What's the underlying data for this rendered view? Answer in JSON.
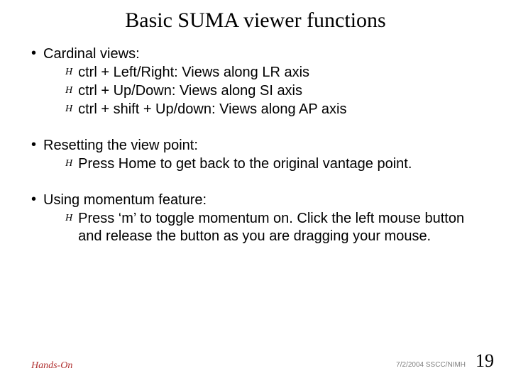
{
  "title": "Basic SUMA viewer functions",
  "sections": [
    {
      "header": "Cardinal views:",
      "items": [
        "ctrl + Left/Right: Views along LR axis",
        "ctrl + Up/Down: Views along SI axis",
        "ctrl + shift + Up/down: Views along AP axis"
      ]
    },
    {
      "header": "Resetting the view point:",
      "items": [
        "Press Home to get back to the original vantage point."
      ]
    },
    {
      "header": "Using momentum feature:",
      "items": [
        "Press ‘m’ to toggle momentum on. Click the left mouse button and release the button as you are dragging your mouse."
      ]
    }
  ],
  "footer": {
    "left": "Hands-On",
    "date": "7/2/2004 SSCC/NIMH",
    "page": "19"
  }
}
